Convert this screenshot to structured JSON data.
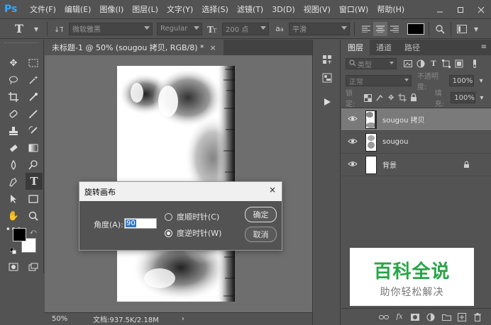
{
  "app": {
    "logo": "Ps",
    "menu": [
      "文件(F)",
      "编辑(E)",
      "图像(I)",
      "图层(L)",
      "文字(Y)",
      "选择(S)",
      "滤镜(T)",
      "3D(D)",
      "视图(V)",
      "窗口(W)",
      "帮助(H)"
    ],
    "window_controls": [
      "minimize-icon",
      "maximize-icon",
      "close-icon"
    ]
  },
  "options": {
    "tool_glyph": "T",
    "font_family": "微软雅黑",
    "font_style": "Regular",
    "font_size": "200 点",
    "aa_label": "a",
    "anti_alias": "平滑",
    "text_color": "#000000"
  },
  "document": {
    "tab_title": "未标题-1 @ 50% (sougou 拷贝, RGB/8) *",
    "close": "×",
    "zoom": "50%",
    "doc_info": "文档:937.5K/2.18M",
    "arrow": "›"
  },
  "layers_panel": {
    "tabs": [
      "图层",
      "通道",
      "路径"
    ],
    "filter_label": "类型",
    "blend_mode": "正常",
    "opacity_label": "不透明度:",
    "opacity_value": "100%",
    "lock_label": "锁定:",
    "fill_label": "填充:",
    "fill_value": "100%",
    "layers": [
      {
        "name": "sougou 拷贝",
        "selected": true
      },
      {
        "name": "sougou",
        "selected": false
      },
      {
        "name": "背景",
        "selected": false,
        "locked": true
      }
    ]
  },
  "dialog": {
    "title": "旋转画布",
    "close": "×",
    "angle_label": "角度(A):",
    "angle_value": "90",
    "option_cw": "度顺时针(C)",
    "option_ccw": "度逆时针(W)",
    "selected_option": "ccw",
    "ok": "确定",
    "cancel": "取消"
  },
  "watermark": {
    "main": "百科全说",
    "sub": "助你轻松解决"
  }
}
